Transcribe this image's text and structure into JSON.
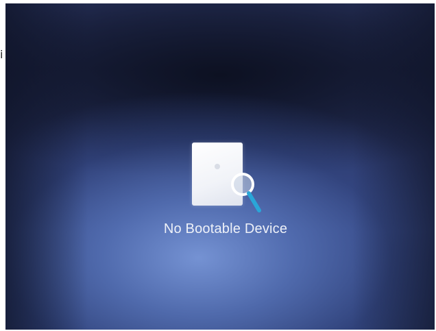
{
  "stray_char": "i",
  "screen": {
    "message": "No Bootable Device",
    "icon": "document-search-icon",
    "colors": {
      "background_dark": "#1a2140",
      "background_light": "#7896d7",
      "document": "#ffffff",
      "magnifier_lens": "#c9d3e3",
      "magnifier_handle": "#2aa6d8",
      "text": "#eef1f8"
    }
  }
}
